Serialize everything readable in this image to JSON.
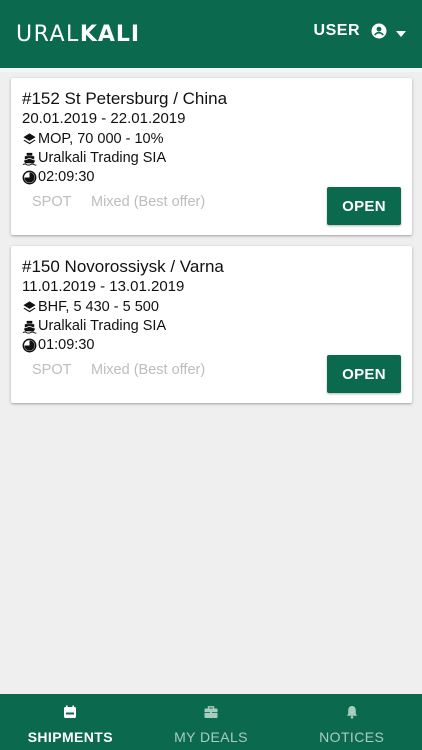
{
  "header": {
    "logo_light": "URAL",
    "logo_bold": "KALI",
    "user_label": "USER"
  },
  "shipments": [
    {
      "title": "#152 St Petersburg / China",
      "dates": "20.01.2019 - 22.01.2019",
      "product": "MOP, 70 000 - 10%",
      "company": "Uralkali Trading SIA",
      "timer": "02:09:30",
      "tag_type": "SPOT",
      "tag_mode": "Mixed (Best offer)",
      "open_label": "OPEN"
    },
    {
      "title": "#150 Novorossiysk / Varna",
      "dates": "11.01.2019 - 13.01.2019",
      "product": "BHF, 5 430 - 5 500",
      "company": "Uralkali Trading SIA",
      "timer": "01:09:30",
      "tag_type": "SPOT",
      "tag_mode": "Mixed (Best offer)",
      "open_label": "OPEN"
    }
  ],
  "bottom_nav": {
    "items": [
      {
        "label": "SHIPMENTS",
        "icon": "calendar-icon",
        "active": true
      },
      {
        "label": "MY DEALS",
        "icon": "briefcase-icon",
        "active": false
      },
      {
        "label": "NOTICES",
        "icon": "bell-icon",
        "active": false
      }
    ]
  },
  "colors": {
    "brand_green": "#0b6a4e",
    "inactive_nav": "#a8cdbf",
    "tag_gray": "#bdbdbd"
  }
}
